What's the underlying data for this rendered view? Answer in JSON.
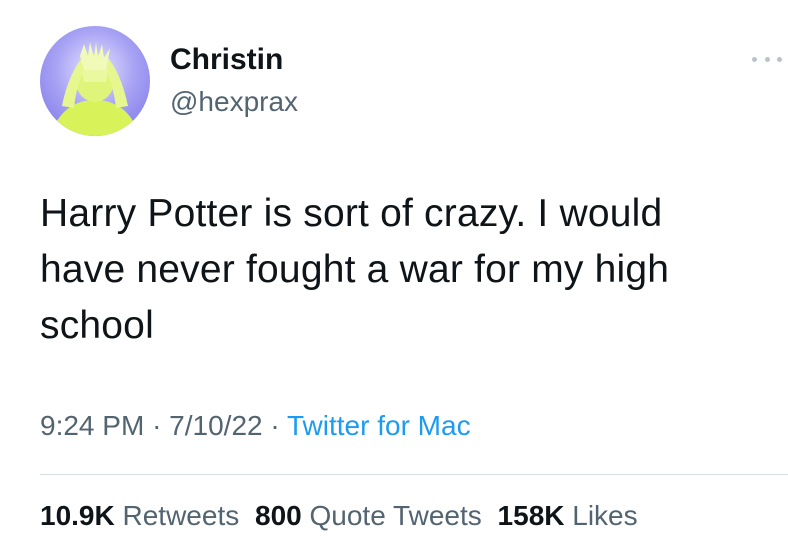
{
  "author": {
    "display_name": "Christin",
    "handle": "@hexprax",
    "avatar_icon": "avatar-hands-over-face"
  },
  "more_icon": "more-dots-icon",
  "tweet": {
    "lines": [
      "Harry Potter is sort of crazy. I would",
      "have never fought a war for my high",
      "school"
    ]
  },
  "meta": {
    "time": "9:24 PM",
    "separator": "·",
    "date": "7/10/22",
    "source": "Twitter for Mac"
  },
  "stats": {
    "retweets_count": "10.9K",
    "retweets_label": "Retweets",
    "quotes_count": "800",
    "quotes_label": "Quote Tweets",
    "likes_count": "158K",
    "likes_label": "Likes"
  },
  "colors": {
    "text": "#0f1419",
    "secondary": "#536471",
    "link": "#1d9bf0",
    "avatar_bg": "#9f9bf2",
    "avatar_figure": "#d8f25a"
  }
}
